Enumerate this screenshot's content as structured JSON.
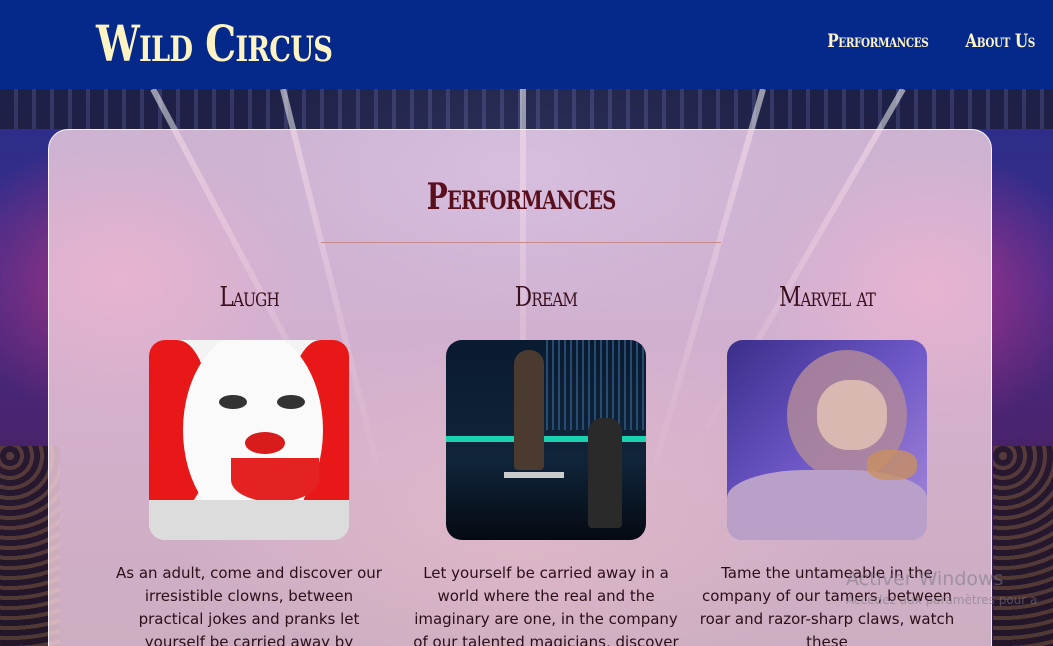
{
  "header": {
    "logo": "Wild Circus",
    "nav": [
      {
        "label": "Performances"
      },
      {
        "label": "About Us"
      }
    ]
  },
  "main": {
    "title": "Performances",
    "cards": [
      {
        "heading": "Laugh",
        "image": "clown-photo",
        "text": "As an adult, come and discover our irresistible clowns, between practical jokes and pranks let yourself be carried away by"
      },
      {
        "heading": "Dream",
        "image": "magician-photo",
        "text": "Let yourself be carried away in a world where the real and the imaginary are one, in the company of our talented magicians, discover a"
      },
      {
        "heading": "Marvel at",
        "image": "lion-tamer-photo",
        "text": "Tame the untameable in the company of our tamers, between roar and razor-sharp claws, watch these"
      }
    ]
  },
  "watermark": {
    "line1": "Activer Windows",
    "line2": "Accédez aux paramètres pour a"
  },
  "colors": {
    "header_bg": "#04298a",
    "logo": "#fdf3c3",
    "title": "#5a0f1c",
    "panel": "rgba(250,215,230,0.78)"
  }
}
